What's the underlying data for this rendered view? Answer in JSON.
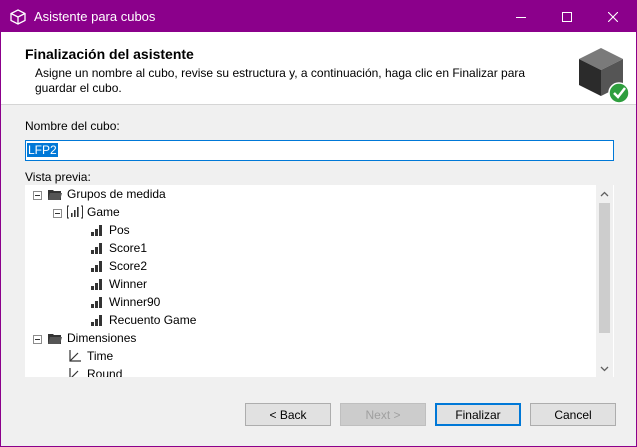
{
  "window": {
    "title": "Asistente para cubos",
    "titlebar_color": "#8b008b"
  },
  "header": {
    "title": "Finalización del asistente",
    "description": "Asigne un nombre al cubo, revise su estructura y, a continuación, haga clic en Finalizar para guardar el cubo."
  },
  "form": {
    "name_label": "Nombre del cubo:",
    "name_value": "LFP2",
    "preview_label": "Vista previa:"
  },
  "tree": {
    "measure_groups": "Grupos de medida",
    "group": "Game",
    "measures": [
      "Pos",
      "Score1",
      "Score2",
      "Winner",
      "Winner90",
      "Recuento Game"
    ],
    "dimensions": "Dimensiones",
    "dimension_items": [
      "Time",
      "Round"
    ]
  },
  "buttons": {
    "back": "< Back",
    "next": "Next >",
    "finish": "Finalizar",
    "cancel": "Cancel"
  },
  "colors": {
    "accent": "#0078d7",
    "success": "#2e9e3e"
  }
}
